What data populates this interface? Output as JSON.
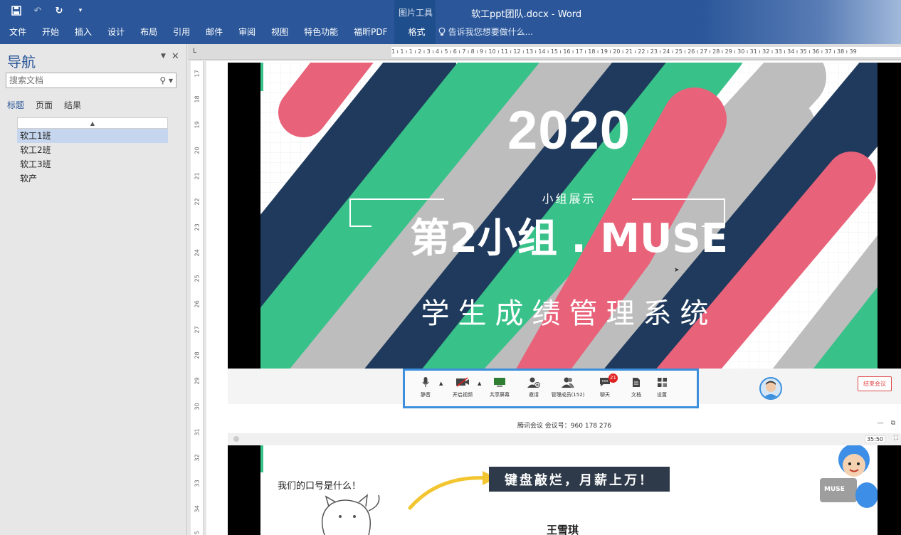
{
  "word": {
    "doc_title": "软工ppt团队.docx - Word",
    "context_group": "图片工具",
    "tabs": [
      "文件",
      "开始",
      "插入",
      "设计",
      "布局",
      "引用",
      "邮件",
      "审阅",
      "视图",
      "特色功能",
      "福昕PDF"
    ],
    "context_tab": "格式",
    "tell_me": "告诉我您想要做什么...",
    "accent": "#2b579a"
  },
  "nav": {
    "title": "导航",
    "search_placeholder": "搜索文档",
    "tabs": [
      "标题",
      "页面",
      "结果"
    ],
    "items": [
      "软工1班",
      "软工2班",
      "软工3班",
      "软产"
    ]
  },
  "ruler": {
    "corner": "L",
    "h_numbers": "1 ı 1 ı 1 ı 2 ı 3 ı 4 ı 5 ı 6 ı 7 ı 8 ı 9 ı 10 ı 11 ı 12 ı 13 ı 14 ı 15 ı 16 ı 17 ı 18 ı 19 ı 20 ı 21 ı 22 ı 23 ı 24 ı 25 ı 26 ı 27 ı 28 ı 29 ı 30 ı 31 ı 32 ı 33 ı 34 ı 35 ı 36 ı 37 ı 38 ı 39",
    "v_numbers": [
      "17",
      "18",
      "19",
      "20",
      "21",
      "22",
      "23",
      "24",
      "25",
      "26",
      "27",
      "28",
      "29",
      "30",
      "31",
      "32",
      "33",
      "34",
      "35"
    ]
  },
  "slide1": {
    "year": "2020",
    "subtitle": "小组展示",
    "group": "第2小组 . MUSE",
    "system": "学生成绩管理系统"
  },
  "meeting": {
    "tools": [
      {
        "icon": "microphone-icon",
        "label": "静音"
      },
      {
        "icon": "camera-off-icon",
        "label": "开启视频"
      },
      {
        "icon": "screen-share-icon",
        "label": "共享屏幕"
      },
      {
        "icon": "invite-icon",
        "label": "邀请"
      },
      {
        "icon": "members-icon",
        "label": "管理成员(152)"
      },
      {
        "icon": "chat-icon",
        "label": "聊天"
      },
      {
        "icon": "document-icon",
        "label": "文档"
      },
      {
        "icon": "settings-icon",
        "label": "设置"
      }
    ],
    "chat_badge": "21",
    "end_label": "结束会议",
    "title": "腾讯会议 会议号：960 178 276",
    "timer": "35:50",
    "highlight": "#3c8fdd"
  },
  "slide2": {
    "question": "我们的口号是什么！",
    "slogan": "键盘敲烂，月薪上万！",
    "name": "王雪琪",
    "logo_text": "MUSE"
  }
}
